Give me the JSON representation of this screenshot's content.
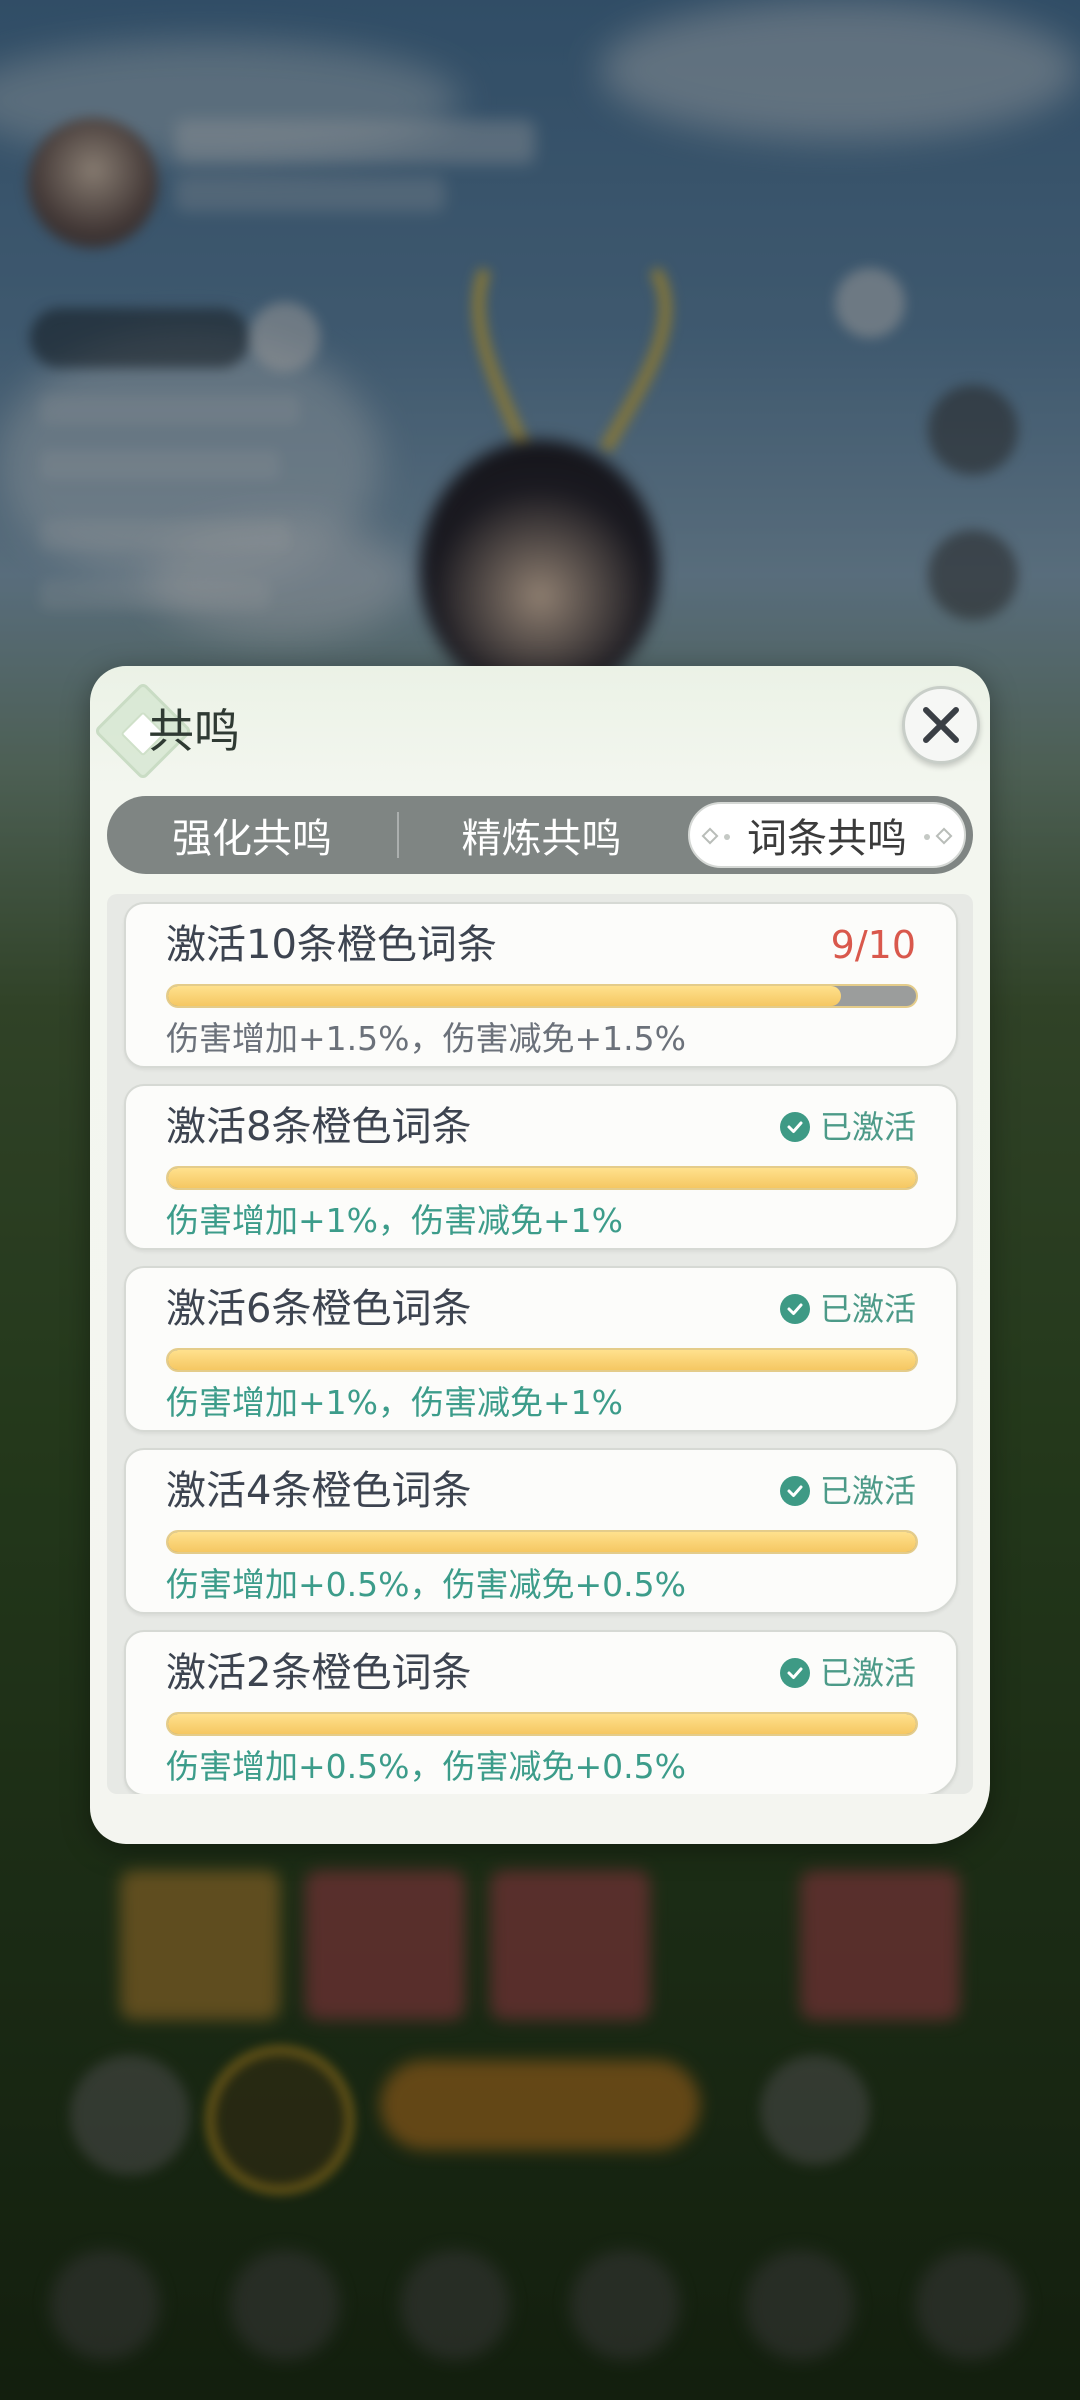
{
  "dialog": {
    "title": "共鸣",
    "close_icon": "close-icon"
  },
  "tabs": [
    {
      "label": "强化共鸣",
      "selected": false
    },
    {
      "label": "精炼共鸣",
      "selected": false
    },
    {
      "label": "词条共鸣",
      "selected": true
    }
  ],
  "resonance_items": [
    {
      "title": "激活10条橙色词条",
      "status": "9/10",
      "progress": 0.9,
      "activated": false,
      "desc": "伤害增加+1.5%，伤害减免+1.5%"
    },
    {
      "title": "激活8条橙色词条",
      "status": "已激活",
      "progress": 1.0,
      "activated": true,
      "desc": "伤害增加+1%，伤害减免+1%"
    },
    {
      "title": "激活6条橙色词条",
      "status": "已激活",
      "progress": 1.0,
      "activated": true,
      "desc": "伤害增加+1%，伤害减免+1%"
    },
    {
      "title": "激活4条橙色词条",
      "status": "已激活",
      "progress": 1.0,
      "activated": true,
      "desc": "伤害增加+0.5%，伤害减免+0.5%"
    },
    {
      "title": "激活2条橙色词条",
      "status": "已激活",
      "progress": 1.0,
      "activated": true,
      "desc": "伤害增加+0.5%，伤害减免+0.5%"
    }
  ],
  "colors": {
    "progress_fill": "#f5c762",
    "progress_track": "#9b9d9c",
    "count_text": "#d9584c",
    "activated_text": "#4c9a88"
  }
}
